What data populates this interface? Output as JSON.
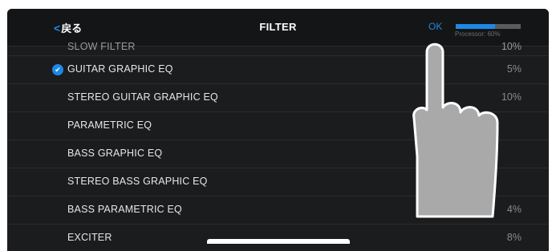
{
  "header": {
    "back_label": "戻る",
    "title": "FILTER",
    "ok_label": "OK",
    "processor_label": "Processor: 60%",
    "processor_value": 0.6
  },
  "effects": [
    {
      "name": "SLOW FILTER",
      "pct": "10%",
      "selected": false
    },
    {
      "name": "GUITAR GRAPHIC EQ",
      "pct": "5%",
      "selected": true
    },
    {
      "name": "STEREO GUITAR GRAPHIC EQ",
      "pct": "10%",
      "selected": false
    },
    {
      "name": "PARAMETRIC EQ",
      "pct": "",
      "selected": false
    },
    {
      "name": "BASS GRAPHIC EQ",
      "pct": "",
      "selected": false
    },
    {
      "name": "STEREO BASS GRAPHIC EQ",
      "pct": "",
      "selected": false
    },
    {
      "name": "BASS PARAMETRIC EQ",
      "pct": "4%",
      "selected": false
    },
    {
      "name": "EXCITER",
      "pct": "8%",
      "selected": false
    }
  ],
  "colors": {
    "accent": "#1e88e5",
    "background": "#1b1c1e",
    "header": "#141516",
    "hand": "#a8a9a8"
  },
  "icons": {
    "back": "chevron-left-icon",
    "selected": "checkmark-circle-icon",
    "overlay": "pointing-hand-icon"
  }
}
